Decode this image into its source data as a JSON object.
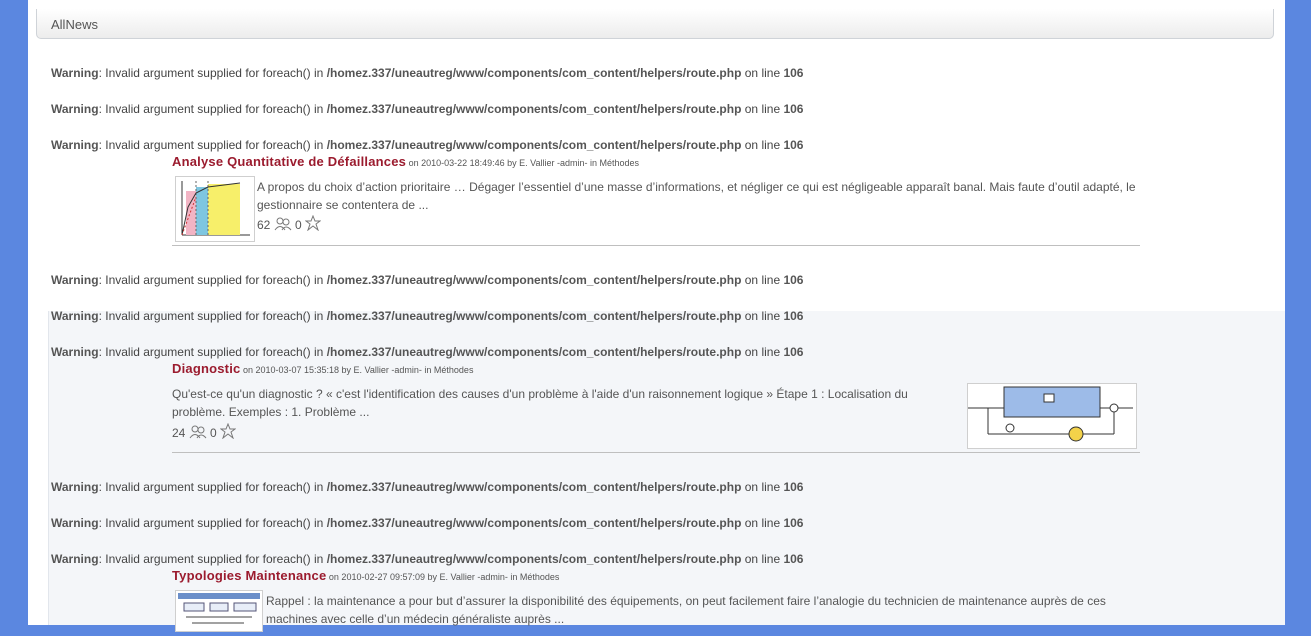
{
  "module": {
    "title": "AllNews"
  },
  "warning": {
    "label": "Warning",
    "message": ": Invalid argument supplied for foreach() in ",
    "path": "/homez.337/uneautreg/www/components/com_content/helpers/route.php",
    "on_line": " on line ",
    "line": "106"
  },
  "articles": [
    {
      "title": "Analyse Quantitative de Défaillances",
      "meta": " on 2010-03-22 18:49:46 by E. Vallier -admin- in Méthodes",
      "text": "  A propos du choix d’action prioritaire … Dégager l’essentiel d’une masse d’informations, et négliger ce qui est négligeable apparaît banal. Mais faute d’outil adapté, le gestionnaire se contentera de ...",
      "views": "62",
      "favs": "0"
    },
    {
      "title": "Diagnostic",
      "meta": " on 2010-03-07 15:35:18 by E. Vallier -admin- in Méthodes",
      "text": "Qu'est-ce qu'un diagnostic ? « c'est l'identification des causes d'un problème à l'aide d'un raisonnement logique »   Étape 1 : Localisation du problème. Exemples : 1. Problème ...",
      "views": "24",
      "favs": "0"
    },
    {
      "title": "Typologies Maintenance",
      "meta": " on 2010-02-27 09:57:09 by E. Vallier -admin- in Méthodes",
      "text": "Rappel : la maintenance a pour but d’assurer la disponibilité des équipements, on peut facilement faire l’analogie du technicien de maintenance auprès de ces machines avec celle d’un médecin généraliste auprès ..."
    }
  ]
}
